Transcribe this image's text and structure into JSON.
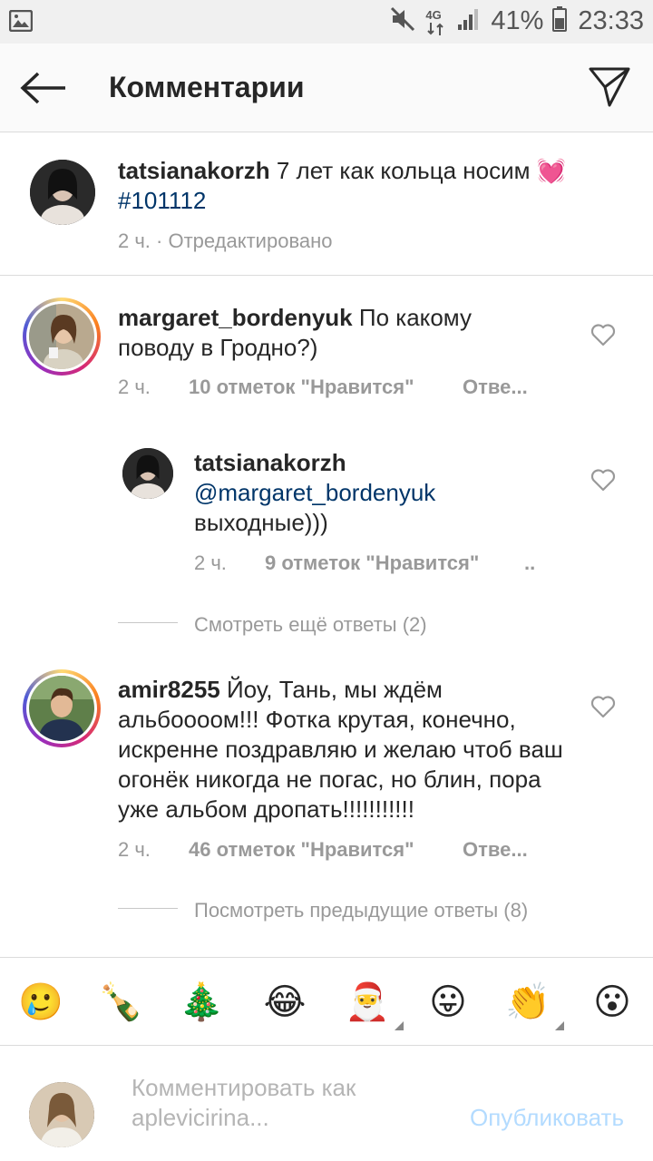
{
  "status_bar": {
    "icons": [
      "image-notification-icon",
      "mute-icon",
      "network-4g-icon",
      "signal-icon",
      "battery-icon"
    ],
    "network_label": "4G",
    "battery": "41%",
    "time": "23:33"
  },
  "header": {
    "title": "Комментарии",
    "back_icon": "arrow-left-icon",
    "send_icon": "direct-send-icon"
  },
  "caption": {
    "username": "tatsianakorzh",
    "text": " 7 лет как кольца носим ",
    "emoji": "💓",
    "hashtag": "#101112",
    "time": "2 ч.",
    "separator": " · ",
    "edited": "Отредактировано"
  },
  "comments": [
    {
      "username": "margaret_bordenyuk",
      "text": " По какому поводу в Гродно?)",
      "time": "2 ч.",
      "likes": "10 отметок \"Нравится\"",
      "reply": "Отве..."
    },
    {
      "username": "tatsianakorzh",
      "mention": "@margaret_bordenyuk",
      "text": "выходные)))",
      "time": "2 ч.",
      "likes": "9 отметок \"Нравится\"",
      "reply": ".."
    },
    {
      "username": "amir8255",
      "text": " Йоу, Тань, мы ждём альбоооом!!! Фотка крутая, конечно, искренне поздравляю и желаю чтоб ваш огонёк никогда не погас, но блин, пора уже альбом дропать!!!!!!!!!!!",
      "time": "2 ч.",
      "likes": "46 отметок \"Нравится\"",
      "reply": "Отве..."
    }
  ],
  "more_replies": "Смотреть ещё ответы (2)",
  "previous_replies": "Посмотреть предыдущие ответы (8)",
  "emoji_bar": [
    {
      "glyph": "🥲",
      "name": "crying-face-emoji",
      "variants": false
    },
    {
      "glyph": "🍾",
      "name": "champagne-emoji",
      "variants": false
    },
    {
      "glyph": "🎄",
      "name": "christmas-tree-emoji",
      "variants": false
    },
    {
      "glyph": "😂",
      "name": "tears-of-joy-emoji",
      "variants": false
    },
    {
      "glyph": "🎅",
      "name": "santa-emoji",
      "variants": true
    },
    {
      "glyph": "😛",
      "name": "tongue-out-emoji",
      "variants": false
    },
    {
      "glyph": "👏",
      "name": "clapping-hands-emoji",
      "variants": true
    },
    {
      "glyph": "😮",
      "name": "surprised-face-emoji",
      "variants": false
    }
  ],
  "composer": {
    "placeholder": "Комментировать как aplevicirina...",
    "publish": "Опубликовать"
  }
}
